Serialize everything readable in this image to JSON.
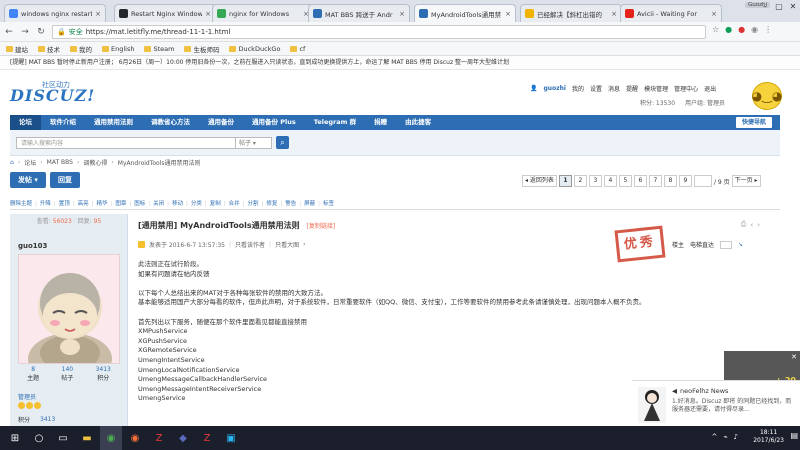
{
  "browser": {
    "tabs": [
      {
        "title": "windows nginx restart",
        "icon": "google-icon",
        "color": "#4285f4"
      },
      {
        "title": "Restart Nginx Window",
        "icon": "github-icon",
        "color": "#24292e"
      },
      {
        "title": "nginx for Windows",
        "icon": "google-icon",
        "color": "#34a853"
      },
      {
        "title": "MAT BBS 跨送于 Andr",
        "icon": "mat-icon",
        "color": "#2c6db3"
      },
      {
        "title": "MyAndroidTools通用禁",
        "icon": "mat-icon",
        "color": "#2c6db3"
      },
      {
        "title": "已经解决【斜杠出错的",
        "icon": "bookmark-icon",
        "color": "#f0b400"
      },
      {
        "title": "Avicii - Waiting For",
        "icon": "youtube-icon",
        "color": "#e62117"
      }
    ],
    "user_badge": "Guozhi",
    "secure_label": "安全",
    "url": "https://mat.letitfly.me/thread-11-1-1.html",
    "bookmarks": [
      "建站",
      "技术",
      "我的",
      "English",
      "Steam",
      "生板师码",
      "DuckDuckGo",
      "cf"
    ]
  },
  "site": {
    "notice": "[提醒] MAT BBS 暂时停止新用户注册； 6月26日（周一）10:00 停用旧各份一次，之前在服进入只读状态，直到成功更换提供方上，命运了解 MAT BBS 停用 Discuz 整一周年大型维计划",
    "logo": "DISCUZ!",
    "logo_sub": "社区动力",
    "user": {
      "name": "guozhi",
      "links": [
        "我的",
        "设置",
        "消息",
        "提醒",
        "模块管理",
        "管理中心",
        "退出"
      ],
      "points_label": "积分: 13530",
      "group_label": "用户组: 管理员"
    },
    "nav": [
      "论坛",
      "软件介绍",
      "通用禁用法则",
      "调教省心方法",
      "通用备份",
      "通用备份 Plus",
      "Telegram 群",
      "捐赠",
      "由此捷客"
    ],
    "quicknav": "快捷导航",
    "search_placeholder": "请输入搜索内容",
    "search_scope": "帖子",
    "breadcrumb": [
      "论坛",
      "MAT BBS",
      "调教心得",
      "MyAndroidTools通用禁用法则"
    ],
    "post_button": "发帖",
    "reply_button": "回复",
    "pager": {
      "prev": "返回列表",
      "pages": [
        "1",
        "2",
        "3",
        "4",
        "5",
        "6",
        "7",
        "8",
        "9"
      ],
      "current": "1",
      "total": "/ 9 页",
      "next": "下一页"
    },
    "toolbar": [
      "删除主题",
      "升降",
      "置顶",
      "高亮",
      "精华",
      "图章",
      "图标",
      "关闭",
      "移动",
      "分类",
      "复制",
      "合并",
      "分割",
      "修复",
      "警告",
      "屏蔽",
      "标签"
    ]
  },
  "post": {
    "views_label": "查看:",
    "views": "56023",
    "replies_label": "回复:",
    "replies": "95",
    "author": "guo103",
    "stats": [
      {
        "n": "8",
        "l": "主题"
      },
      {
        "n": "140",
        "l": "帖子"
      },
      {
        "n": "3413",
        "l": "积分"
      }
    ],
    "group": "管理员",
    "credit_label": "积分",
    "credit": "3413",
    "title": "[通用禁用] MyAndroidTools通用禁用法则",
    "title_tag": "[复制链接]",
    "meta": {
      "posted": "发表于 2016-6-7 13:57:35",
      "author_only": "只看该作者",
      "big": "只看大图",
      "floor": "楼主",
      "font_label": "电梯直达"
    },
    "stamp": "优秀",
    "body": [
      "此法则正在试行阶段。",
      "如果有问题请在帖内反馈",
      "",
      "以下每个人总结出来的MAT对于各种每张软件的禁用的大致方法。",
      "基本能够适用国产大部分每看的软件，但声此声明，对于系统软件，日常重要软件（如QQ、微信、支付宝），工作等要软件的禁用参考此条请谨慎处理，出现问题本人概不负责。",
      "",
      "首先列出以下服务，随便在那个软件里面看见都能直接禁用",
      "XMPushService",
      "XGPushService",
      "XGRemoteService",
      "UmengIntentService",
      "UmengLocalNotificationService",
      "UmengMessageCallbackHandlerService",
      "UmengMessageIntentReceiverService",
      "UmengService"
    ]
  },
  "overlay": {
    "side_text": "+ 20",
    "news_title": "neoFelhz News",
    "news_body": "1.好消息。Discuz 即将 的同题已经找到，而服务器还需要，请付得尽录..."
  },
  "taskbar": {
    "time": "18:11",
    "date": "2017/6/23"
  }
}
